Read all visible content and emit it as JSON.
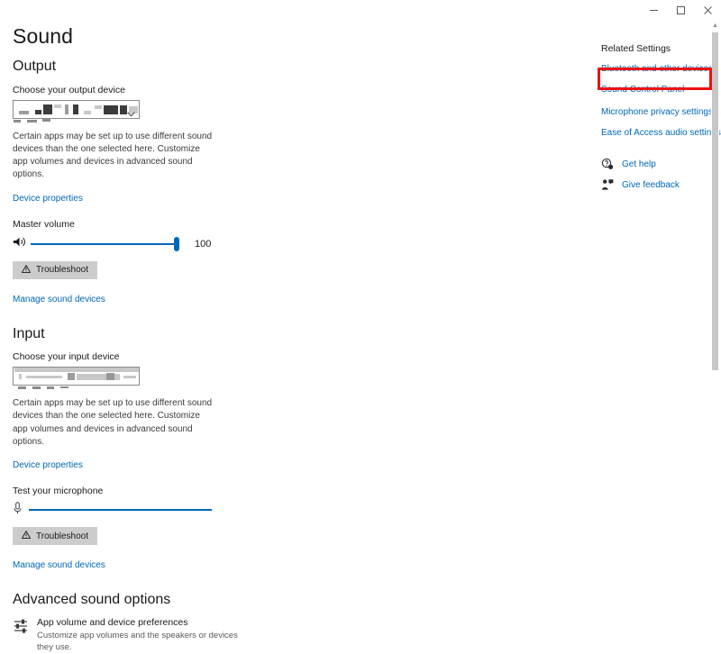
{
  "window": {
    "minimize_label": "–",
    "maximize_label": "□",
    "close_label": "✕"
  },
  "page": {
    "title": "Sound"
  },
  "output": {
    "heading": "Output",
    "device_label": "Choose your output device",
    "device_value": "",
    "note": "Certain apps may be set up to use different sound devices than the one selected here. Customize app volumes and devices in advanced sound options.",
    "device_properties_link": "Device properties",
    "volume_label": "Master volume",
    "volume_value": "100",
    "speaker_icon": "speaker-icon",
    "troubleshoot_label": "Troubleshoot",
    "warning_icon": "⚠",
    "manage_link": "Manage sound devices"
  },
  "input": {
    "heading": "Input",
    "device_label": "Choose your input device",
    "device_value": "",
    "note": "Certain apps may be set up to use different sound devices than the one selected here. Customize app volumes and devices in advanced sound options.",
    "device_properties_link": "Device properties",
    "test_label": "Test your microphone",
    "mic_icon": "microphone-icon",
    "troubleshoot_label": "Troubleshoot",
    "warning_icon": "⚠",
    "manage_link": "Manage sound devices"
  },
  "advanced": {
    "heading": "Advanced sound options",
    "app_volume_title": "App volume and device preferences",
    "app_volume_desc": "Customize app volumes and the speakers or devices they use.",
    "app_volume_icon": "sliders-icon"
  },
  "related": {
    "title": "Related Settings",
    "links": [
      {
        "label": "Bluetooth and other devices"
      },
      {
        "label": "Sound Control Panel"
      },
      {
        "label": "Microphone privacy settings"
      },
      {
        "label": "Ease of Access audio settings"
      }
    ],
    "help": [
      {
        "label": "Get help",
        "icon": "get-help-icon"
      },
      {
        "label": "Give feedback",
        "icon": "give-feedback-icon"
      }
    ]
  },
  "annotation": {
    "highlight_target": "Sound Control Panel",
    "color": "#ee1111"
  },
  "colors": {
    "accent": "#0067b8",
    "link": "#0067b8",
    "background": "#ffffff",
    "button": "#cccccc",
    "highlight": "#ee1111"
  },
  "scrollbar": {
    "up_arrow": "▲"
  }
}
